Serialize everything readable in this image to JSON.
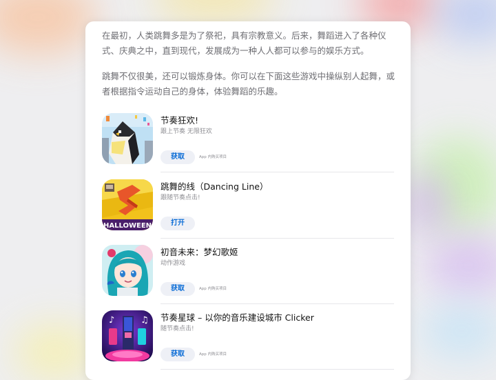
{
  "article": {
    "paragraphs": [
      "在最初，人类跳舞多是为了祭祀，具有宗教意义。后来，舞蹈进入了各种仪式、庆典之中，直到现代，发展成为一种人人都可以参与的娱乐方式。",
      "跳舞不仅很美，还可以锻炼身体。你可以在下面这些游戏中操纵别人起舞，或者根据指令运动自己的身体，体验舞蹈的乐趣。"
    ]
  },
  "apps": [
    {
      "title": "节奏狂欢!",
      "subtitle": "跟上节奏 无限狂欢",
      "button": "获取",
      "iap": "App 内购买项目",
      "icon": "penguin-icon"
    },
    {
      "title": "跳舞的线（Dancing Line）",
      "subtitle": "跟随节奏点击!",
      "button": "打开",
      "iap": "",
      "icon": "dancing-line-icon",
      "icon_text": "HALLOWEEN"
    },
    {
      "title": "初音未来：梦幻歌姬",
      "subtitle": "动作游戏",
      "button": "获取",
      "iap": "App 内购买项目",
      "icon": "miku-icon"
    },
    {
      "title": "节奏星球 – 以你的音乐建设城市 Clicker",
      "subtitle": "随节奏点击!",
      "button": "获取",
      "iap": "App 内购买项目",
      "icon": "music-planet-icon"
    }
  ],
  "colors": {
    "button_text": "#0a6cd6",
    "button_bg": "#eef0f6",
    "body_text": "#6e6e73"
  }
}
